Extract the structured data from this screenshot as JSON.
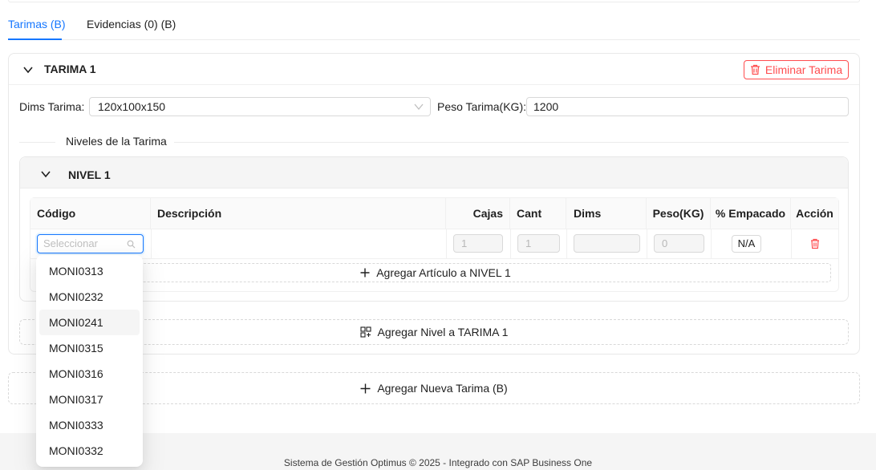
{
  "tabs": [
    {
      "label": "Tarimas (B)",
      "active": true
    },
    {
      "label": "Evidencias (0) (B)",
      "active": false
    }
  ],
  "pallet": {
    "title": "TARIMA 1",
    "delete_label": "Eliminar Tarima",
    "dims_label": "Dims Tarima",
    "dims_value": "120x100x150",
    "weight_label": "Peso Tarima(KG)",
    "weight_value": "1200",
    "levels_divider": "Niveles de la Tarima",
    "add_level_label": "Agregar Nivel a TARIMA 1"
  },
  "level": {
    "title": "NIVEL 1",
    "columns": [
      "Código",
      "Descripción",
      "Cajas",
      "Cant",
      "Dims",
      "Peso(KG)",
      "% Empacado",
      "Acción"
    ],
    "row": {
      "code_placeholder": "Seleccionar",
      "cajas": "1",
      "cant": "1",
      "dims": "",
      "peso": "0",
      "empacado": "N/A"
    },
    "add_article_label": "Agregar Artículo a NIVEL 1"
  },
  "add_pallet_label": "Agregar Nueva Tarima (B)",
  "dropdown": {
    "options": [
      "MONI0313",
      "MONI0232",
      "MONI0241",
      "MONI0315",
      "MONI0316",
      "MONI0317",
      "MONI0333",
      "MONI0332"
    ],
    "highlighted": "MONI0241"
  },
  "footer": "Sistema de Gestión Optimus © 2025 - Integrado con SAP Business One",
  "colors": {
    "accent": "#1677ff",
    "danger": "#ff4d4f"
  }
}
